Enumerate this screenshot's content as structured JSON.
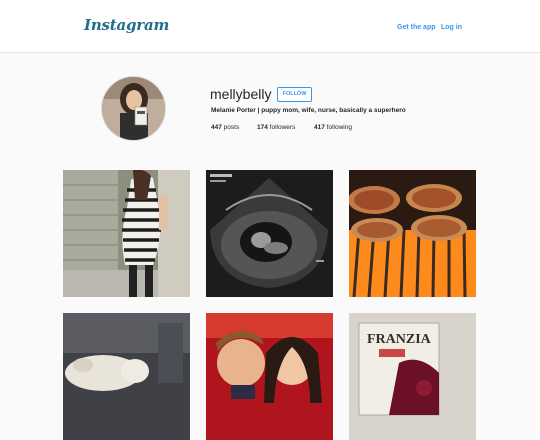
{
  "header": {
    "logo_text": "Instagram",
    "get_app_label": "Get the app",
    "login_label": "Log in"
  },
  "profile": {
    "username": "mellybelly",
    "follow_label": "FOLLOW",
    "bio": "Melanie Porter | puppy mom, wife, nurse, basically a superhero",
    "posts_count": "447",
    "posts_label": "posts",
    "followers_count": "174",
    "followers_label": "followers",
    "following_count": "417",
    "following_label": "following"
  },
  "posts": [
    {
      "subject": "pregnant woman in striped dress by garage"
    },
    {
      "subject": "ultrasound scan"
    },
    {
      "subject": "pizzas on grill"
    },
    {
      "subject": "dog sleeping on couch"
    },
    {
      "subject": "couple selfie"
    },
    {
      "subject": "Franzia wine box"
    }
  ],
  "wine_box_label": "FRANZIA",
  "colors": {
    "link_blue": "#3897f0",
    "logo_blue": "#1f6f8b",
    "background": "#fafafa"
  }
}
